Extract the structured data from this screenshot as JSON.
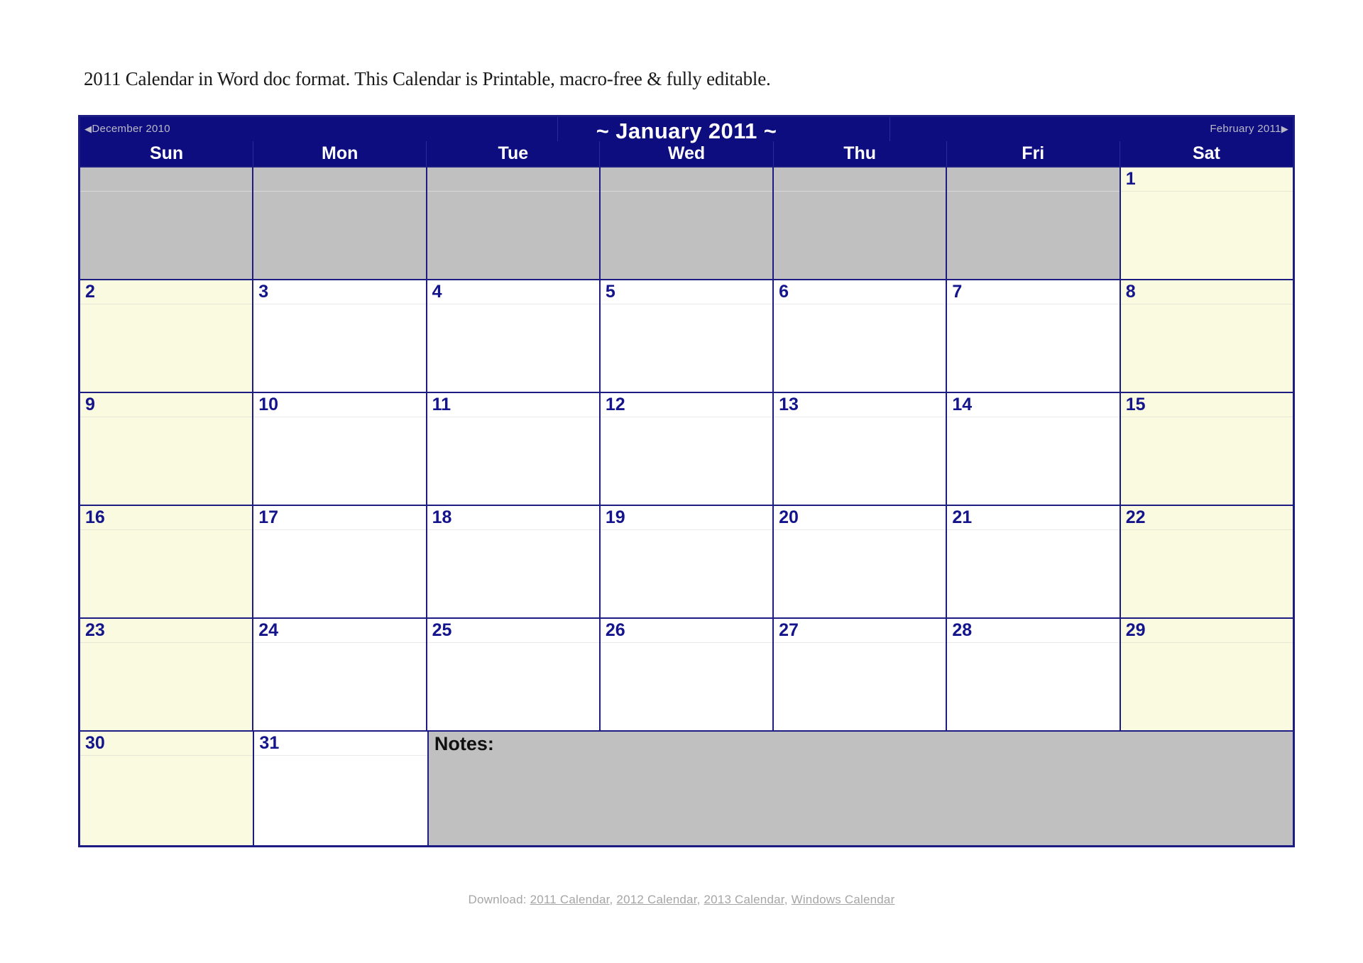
{
  "intro": {
    "text": "2011 Calendar in Word doc format.  This Calendar is Printable, macro-free & fully editable."
  },
  "calendar": {
    "month_title": "~ January 2011 ~",
    "prev_month": "December 2010",
    "next_month": "February 2011",
    "prev_arrow": "◀",
    "next_arrow": "▶",
    "weekdays": [
      "Sun",
      "Mon",
      "Tue",
      "Wed",
      "Thu",
      "Fri",
      "Sat"
    ],
    "notes_label": "Notes:",
    "colors": {
      "header_navy": "#0D0D80",
      "border_navy": "#1C1C82",
      "daynum_navy": "#14148C",
      "weekend_cream": "#FAFAE1",
      "filler_gray": "#C0C0C0",
      "weekday_white": "#FFFFFF",
      "nav_text_gray": "#B9B9C6"
    },
    "weeks": [
      [
        {
          "day": "",
          "kind": "filler"
        },
        {
          "day": "",
          "kind": "filler"
        },
        {
          "day": "",
          "kind": "filler"
        },
        {
          "day": "",
          "kind": "filler"
        },
        {
          "day": "",
          "kind": "filler"
        },
        {
          "day": "",
          "kind": "filler"
        },
        {
          "day": "1",
          "kind": "weekend"
        }
      ],
      [
        {
          "day": "2",
          "kind": "weekend"
        },
        {
          "day": "3",
          "kind": "weekday"
        },
        {
          "day": "4",
          "kind": "weekday"
        },
        {
          "day": "5",
          "kind": "weekday"
        },
        {
          "day": "6",
          "kind": "weekday"
        },
        {
          "day": "7",
          "kind": "weekday"
        },
        {
          "day": "8",
          "kind": "weekend"
        }
      ],
      [
        {
          "day": "9",
          "kind": "weekend"
        },
        {
          "day": "10",
          "kind": "weekday"
        },
        {
          "day": "11",
          "kind": "weekday"
        },
        {
          "day": "12",
          "kind": "weekday"
        },
        {
          "day": "13",
          "kind": "weekday"
        },
        {
          "day": "14",
          "kind": "weekday"
        },
        {
          "day": "15",
          "kind": "weekend"
        }
      ],
      [
        {
          "day": "16",
          "kind": "weekend"
        },
        {
          "day": "17",
          "kind": "weekday"
        },
        {
          "day": "18",
          "kind": "weekday"
        },
        {
          "day": "19",
          "kind": "weekday"
        },
        {
          "day": "20",
          "kind": "weekday"
        },
        {
          "day": "21",
          "kind": "weekday"
        },
        {
          "day": "22",
          "kind": "weekend"
        }
      ],
      [
        {
          "day": "23",
          "kind": "weekend"
        },
        {
          "day": "24",
          "kind": "weekday"
        },
        {
          "day": "25",
          "kind": "weekday"
        },
        {
          "day": "26",
          "kind": "weekday"
        },
        {
          "day": "27",
          "kind": "weekday"
        },
        {
          "day": "28",
          "kind": "weekday"
        },
        {
          "day": "29",
          "kind": "weekend"
        }
      ]
    ],
    "last_week": [
      {
        "day": "30",
        "kind": "weekend"
      },
      {
        "day": "31",
        "kind": "weekday"
      }
    ]
  },
  "footer": {
    "prefix": "Download:",
    "links": [
      "2011 Calendar",
      "2012 Calendar",
      "2013 Calendar",
      "Windows Calendar"
    ],
    "separator": ","
  }
}
